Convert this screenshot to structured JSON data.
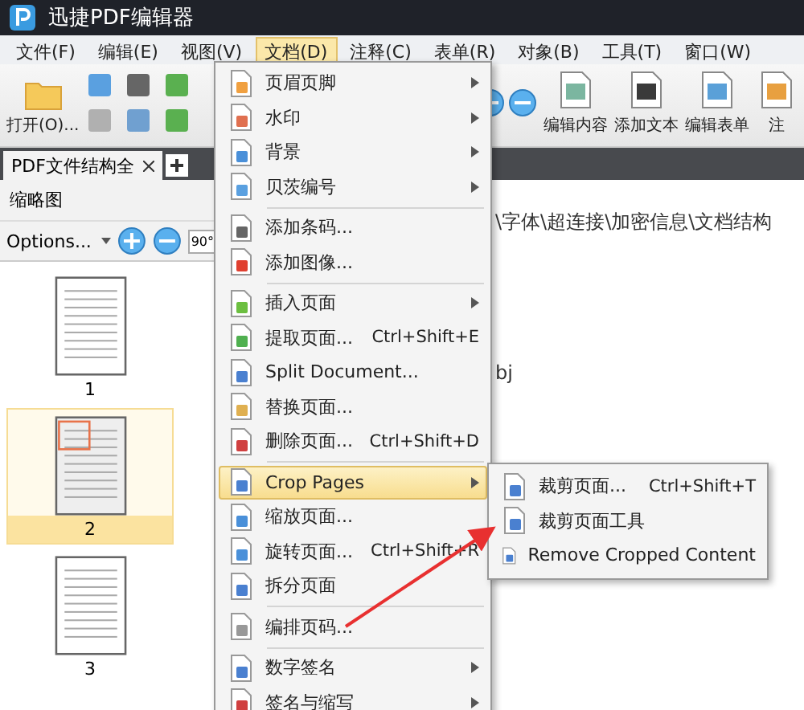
{
  "app": {
    "title": "迅捷PDF编辑器"
  },
  "menubar": [
    {
      "label": "文件(F)",
      "selected": false
    },
    {
      "label": "编辑(E)",
      "selected": false
    },
    {
      "label": "视图(V)",
      "selected": false
    },
    {
      "label": "文档(D)",
      "selected": true
    },
    {
      "label": "注释(C)",
      "selected": false
    },
    {
      "label": "表单(R)",
      "selected": false
    },
    {
      "label": "对象(B)",
      "selected": false
    },
    {
      "label": "工具(T)",
      "selected": false
    },
    {
      "label": "窗口(W)",
      "selected": false
    }
  ],
  "toolbar": {
    "open": "打开(O)...",
    "buttons": [
      "编辑内容",
      "添加文本",
      "编辑表单",
      "注"
    ]
  },
  "tabs": [
    {
      "label": "PDF文件结构全",
      "selected": true
    }
  ],
  "thumbnails_panel": {
    "title": "缩略图",
    "options": "Options...",
    "rotate": "90°",
    "pages": [
      {
        "label": "1",
        "selected": false
      },
      {
        "label": "2",
        "selected": true
      },
      {
        "label": "3",
        "selected": false
      }
    ]
  },
  "document": {
    "lines": [
      "\\字体\\超连接\\加密信息\\文档结构",
      "bj"
    ]
  },
  "menu": {
    "items": [
      {
        "kind": "item",
        "label": "页眉页脚",
        "has_submenu": true,
        "selected": false
      },
      {
        "kind": "item",
        "label": "水印",
        "has_submenu": true,
        "selected": false
      },
      {
        "kind": "item",
        "label": "背景",
        "has_submenu": true,
        "selected": false
      },
      {
        "kind": "item",
        "label": "贝茨编号",
        "has_submenu": true,
        "selected": false
      },
      {
        "kind": "separator"
      },
      {
        "kind": "item",
        "label": "添加条码...",
        "has_submenu": false,
        "selected": false
      },
      {
        "kind": "item",
        "label": "添加图像...",
        "has_submenu": false,
        "selected": false
      },
      {
        "kind": "separator"
      },
      {
        "kind": "item",
        "label": "插入页面",
        "has_submenu": true,
        "selected": false
      },
      {
        "kind": "item",
        "label": "提取页面...",
        "shortcut": "Ctrl+Shift+E",
        "has_submenu": false,
        "selected": false
      },
      {
        "kind": "item",
        "label": "Split Document...",
        "has_submenu": false,
        "selected": false
      },
      {
        "kind": "item",
        "label": "替换页面...",
        "has_submenu": false,
        "selected": false
      },
      {
        "kind": "item",
        "label": "删除页面...",
        "shortcut": "Ctrl+Shift+D",
        "has_submenu": false,
        "selected": false
      },
      {
        "kind": "separator"
      },
      {
        "kind": "item",
        "label": "Crop Pages",
        "has_submenu": true,
        "selected": true
      },
      {
        "kind": "item",
        "label": "缩放页面...",
        "has_submenu": false,
        "selected": false
      },
      {
        "kind": "item",
        "label": "旋转页面...",
        "shortcut": "Ctrl+Shift+R",
        "has_submenu": false,
        "selected": false
      },
      {
        "kind": "item",
        "label": "拆分页面",
        "has_submenu": false,
        "selected": false
      },
      {
        "kind": "separator"
      },
      {
        "kind": "item",
        "label": "编排页码...",
        "has_submenu": false,
        "selected": false
      },
      {
        "kind": "separator"
      },
      {
        "kind": "item",
        "label": "数字签名",
        "has_submenu": true,
        "selected": false
      },
      {
        "kind": "item",
        "label": "签名与缩写",
        "has_submenu": true,
        "selected": false
      }
    ]
  },
  "submenu": {
    "items": [
      {
        "label": "裁剪页面...",
        "shortcut": "Ctrl+Shift+T"
      },
      {
        "label": "裁剪页面工具"
      },
      {
        "label": "Remove Cropped Content"
      }
    ]
  }
}
